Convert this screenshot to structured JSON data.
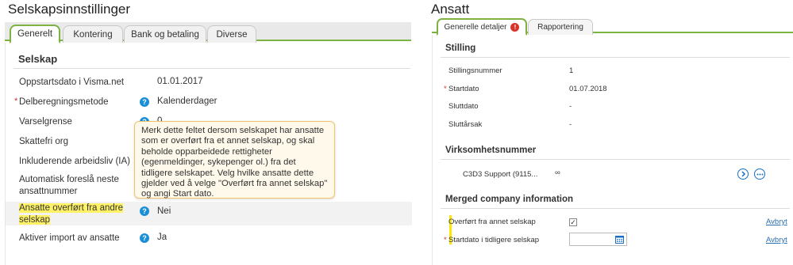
{
  "left": {
    "title": "Selskapsinnstillinger",
    "tabs": [
      "Generelt",
      "Kontering",
      "Bank og betaling",
      "Diverse"
    ],
    "section": "Selskap",
    "rows": [
      {
        "label": "Oppstartsdato i Visma.net",
        "value": "01.01.2017"
      },
      {
        "label": "Delberegningsmetode",
        "value": "Kalenderdager"
      },
      {
        "label": "Varselgrense",
        "value": "0"
      },
      {
        "label": "Skattefri org",
        "value": ""
      },
      {
        "label": "Inkluderende arbeidsliv (IA)",
        "value": ""
      },
      {
        "label_line1": "Automatisk foreslå neste",
        "label_line2": "ansattnummer",
        "value": ""
      },
      {
        "label_line1": "Ansatte overført fra andre",
        "label_line2": "selskap",
        "value": "Nei"
      },
      {
        "label": "Aktiver import av ansatte",
        "value": "Ja"
      }
    ],
    "tooltip": "Merk dette feltet dersom selskapet har ansatte som er overført fra et annet selskap, og skal beholde opparbeidede rettigheter (egenmeldinger, sykepenger ol.) fra det tidligere selskapet. Velg hvilke ansatte dette gjelder ved å velge \"Overført fra annet selskap\" og angi Start dato."
  },
  "right": {
    "title": "Ansatt",
    "tabs": [
      "Generelle detaljer",
      "Rapportering"
    ],
    "badge": "!",
    "sections": {
      "stilling": "Stilling",
      "virksomhet": "Virksomhetsnummer",
      "merged": "Merged company information"
    },
    "stilling_rows": [
      {
        "label": "Stillingsnummer",
        "value": "1"
      },
      {
        "label": "Startdato",
        "value": "01.07.2018"
      },
      {
        "label": "Sluttdato",
        "value": "-"
      },
      {
        "label": "Sluttårsak",
        "value": "-"
      }
    ],
    "virksomhet_value": "C3D3 Support (9115...",
    "virksomhet_symbol": "∞",
    "merged_rows": [
      {
        "label": "Overført fra annet selskap",
        "checked": "✓",
        "link": "Avbryt"
      },
      {
        "label": "Startdato i tidligere selskap",
        "link": "Avbryt"
      }
    ]
  },
  "required_marker": "*",
  "info_glyph": "?",
  "accent": "#7cb342",
  "highlight": "#fff266"
}
